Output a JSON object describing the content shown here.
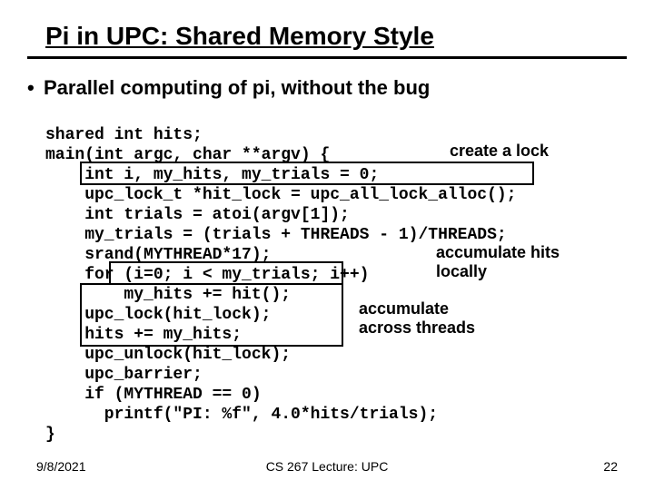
{
  "title": "Pi in UPC: Shared Memory Style",
  "bullet": "Parallel computing of pi, without the bug",
  "code": {
    "l1": "shared int hits;",
    "l2": "main(int argc, char **argv) {",
    "l3": "    int i, my_hits, my_trials = 0;",
    "l4": "    upc_lock_t *hit_lock = upc_all_lock_alloc();",
    "l5": "    int trials = atoi(argv[1]);",
    "l6": "    my_trials = (trials + THREADS - 1)/THREADS;",
    "l7": "    srand(MYTHREAD*17);",
    "l8": "    for (i=0; i < my_trials; i++)",
    "l9": "        my_hits += hit();",
    "l10": "    upc_lock(hit_lock);",
    "l11": "    hits += my_hits;",
    "l12": "    upc_unlock(hit_lock);",
    "l13": "    upc_barrier;",
    "l14": "    if (MYTHREAD == 0)",
    "l15": "      printf(\"PI: %f\", 4.0*hits/trials);",
    "l16": "}"
  },
  "annotations": {
    "create_lock": "create a lock",
    "accumulate_local": "accumulate hits\nlocally",
    "accumulate_across": "accumulate\nacross threads"
  },
  "footer": {
    "date": "9/8/2021",
    "center": "CS 267 Lecture: UPC",
    "page": "22"
  }
}
